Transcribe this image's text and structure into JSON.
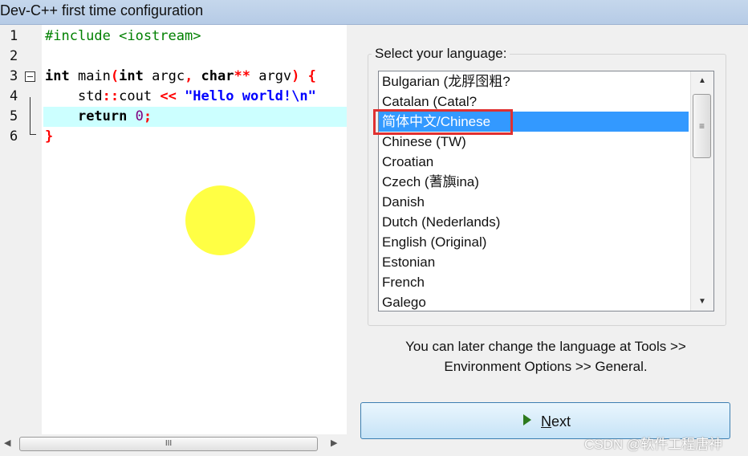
{
  "window": {
    "title": "Dev-C++ first time configuration"
  },
  "editor": {
    "lines": [
      {
        "num": "1"
      },
      {
        "num": "2"
      },
      {
        "num": "3"
      },
      {
        "num": "4"
      },
      {
        "num": "5"
      },
      {
        "num": "6"
      }
    ],
    "tokens": {
      "include": "#include <iostream>",
      "int1": "int",
      "main": " main",
      "paren_open": "(",
      "int2": "int",
      "argc": " argc",
      "comma": ",",
      "char": " char",
      "stars": "**",
      "argv": " argv",
      "paren_close": ")",
      "brace_open": " {",
      "indent": "    ",
      "std": "std",
      "scope": "::",
      "cout": "cout",
      "shift": " << ",
      "string": "\"Hello world!\\n\"",
      "ret_indent": "    ",
      "return": "return",
      "space": " ",
      "zero": "0",
      "semi": ";",
      "brace_close": "}"
    },
    "colors": {
      "current_line": "#ccffff",
      "cursor_highlight": "#ffff44"
    },
    "hscroll_thumb": "III"
  },
  "language_panel": {
    "label": "Select your language:",
    "items": [
      "Bulgarian (龙脬囹粗?",
      "Catalan (Catal?",
      "简体中文/Chinese",
      "Chinese (TW)",
      "Croatian",
      "Czech (蓍旟ina)",
      "Danish",
      "Dutch (Nederlands)",
      "English (Original)",
      "Estonian",
      "French",
      "Galego"
    ],
    "selected_index": 2,
    "selection_color": "#3399ff",
    "annotation_color": "#e03030",
    "scrollbar_grip": "≡"
  },
  "hint": {
    "line1": "You can later change the language at Tools >>",
    "line2": "Environment Options >> General."
  },
  "next_button": {
    "mnemonic": "N",
    "rest": "ext"
  },
  "watermark": "CSDN @软件工程唐神"
}
